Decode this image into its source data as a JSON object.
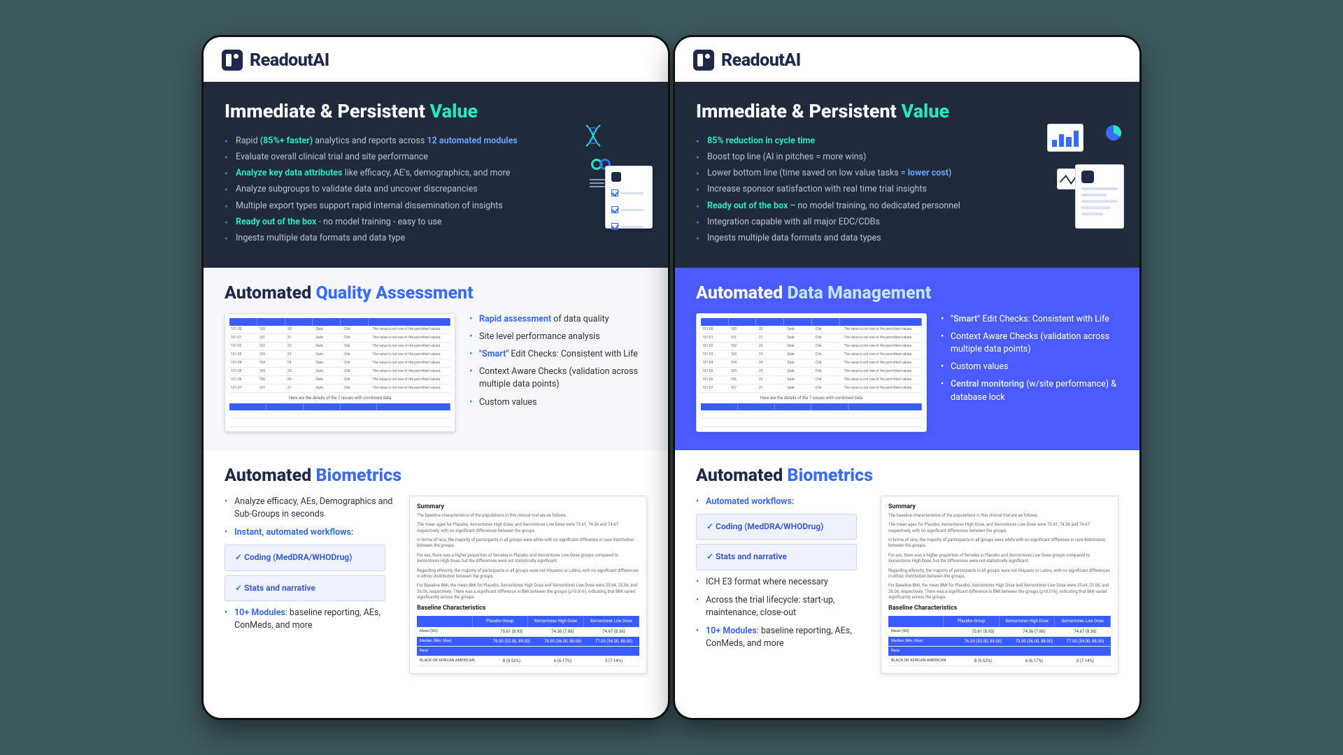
{
  "brand": "ReadoutAI",
  "left": {
    "hero": {
      "title_a": "Immediate & Persistent ",
      "title_b": "Value",
      "items": [
        {
          "pre": "Rapid ",
          "hl": "(85%+ faster)",
          "hl_class": "hl-green",
          "mid": " analytics and reports across ",
          "hl2": "12 automated modules",
          "hl2_class": "hl-blue"
        },
        {
          "text": "Evaluate overall clinical trial and site performance"
        },
        {
          "hl": "Analyze key data attributes",
          "hl_class": "hl-green",
          "post": " like efficacy, AE's, demographics, and more"
        },
        {
          "text": "Analyze subgroups to validate data and uncover discrepancies"
        },
        {
          "text": "Multiple export types support rapid internal dissemination of insights"
        },
        {
          "hl": "Ready out of the box",
          "hl_class": "hl-green",
          "post": " - no model training - easy to use"
        },
        {
          "text": "Ingests multiple data formats and data type"
        }
      ]
    },
    "qa": {
      "title_a": "Automated ",
      "title_b": "Quality Assessment",
      "bullets": [
        {
          "hl": "Rapid assessment",
          "post": " of data quality"
        },
        {
          "text": "Site level performance analysis"
        },
        {
          "hl": "\"Smart\"",
          "post": " Edit Checks: Consistent with Life"
        },
        {
          "text": "Context Aware Checks (validation across multiple data points)"
        },
        {
          "text": "Custom values"
        }
      ],
      "caption": "Here are the details of the 7 issues with combined data"
    },
    "bio": {
      "title_a": "Automated ",
      "title_b": "Biometrics",
      "items": [
        {
          "text": "Analyze efficacy, AEs, Demographics and Sub-Groups in seconds"
        },
        {
          "hl": "Instant, automated workflows:"
        },
        {
          "chips": [
            "Coding (MedDRA/WHODrug)",
            "Stats and narrative"
          ]
        },
        {
          "hl": "10+ Modules",
          "post": ": baseline reporting, AEs, ConMeds, and more"
        }
      ],
      "summary_h": "Summary",
      "baseline_h": "Baseline Characteristics",
      "cols": [
        "",
        "Placebo Group",
        "Xemontorex High Dose",
        "Xemontorex Low Dose"
      ],
      "rows": [
        [
          "Mean (SD)",
          "75.61 (8.93)",
          "74.36 (7.86)",
          "74.67 (8.36)"
        ],
        [
          "Median (Min, Max)",
          "76.00 (52.00, 89.00)",
          "75.00 (56.00, 88.00)",
          "77.00 (54.00, 88.00)"
        ],
        [
          "BLACK OR AFRICAN AMERICAN",
          "8 (9.52%)",
          "6 (6.17%)",
          "5 (7.14%)"
        ]
      ]
    }
  },
  "right": {
    "hero": {
      "title_a": "Immediate & Persistent ",
      "title_b": "Value",
      "items": [
        {
          "hl": "85% reduction in cycle time",
          "hl_class": "hl-green"
        },
        {
          "text": "Boost top line (AI in pitches = more wins)"
        },
        {
          "pre": "Lower bottom line (time saved on low value tasks = ",
          "hl": "lower cost",
          "hl_class": "hl-blue",
          "post": ")"
        },
        {
          "text": "Increase sponsor satisfaction with real time trial insights"
        },
        {
          "hl": "Ready out of the box –",
          "hl_class": "hl-green",
          "post": " no model training, no dedicated personnel"
        },
        {
          "text": "Integration capable with all major EDC/CDBs"
        },
        {
          "text": "Ingests multiple data formats and data types"
        }
      ]
    },
    "dm": {
      "title_a": "Automated ",
      "title_b": "Data Management",
      "bullets": [
        {
          "hl": "\"Smart\"",
          "post": " Edit Checks: Consistent with Life"
        },
        {
          "text": "Context Aware Checks (validation across multiple data points)"
        },
        {
          "text": "Custom values"
        },
        {
          "hl": "Central monitoring",
          "post": " (w/site performance) & database lock"
        }
      ],
      "caption": "Here are the details of the 7 issues with combined data"
    },
    "bio": {
      "title_a": "Automated ",
      "title_b": "Biometrics",
      "items": [
        {
          "hl": "Automated workflows:"
        },
        {
          "chips": [
            "Coding (MedDRA/WHODrug)",
            "Stats and narrative"
          ]
        },
        {
          "text": "ICH E3 format where necessary"
        },
        {
          "text": "Across the trial lifecycle: start-up, maintenance, close-out"
        },
        {
          "hl": "10+ Modules",
          "post": ": baseline reporting, AEs, ConMeds, and more"
        }
      ],
      "summary_h": "Summary",
      "baseline_h": "Baseline Characteristics",
      "cols": [
        "",
        "Placebo Group",
        "Xemontorex High Dose",
        "Xemontorex Low Dose"
      ],
      "rows": [
        [
          "Mean (SD)",
          "75.61 (8.93)",
          "74.36 (7.86)",
          "74.67 (8.36)"
        ],
        [
          "Median (Min, Max)",
          "76.00 (52.00, 89.00)",
          "75.00 (56.00, 88.00)",
          "77.00 (54.00, 88.00)"
        ],
        [
          "BLACK OR AFRICAN AMERICAN",
          "8 (9.52%)",
          "6 (6.17%)",
          "5 (7.14%)"
        ]
      ]
    }
  }
}
